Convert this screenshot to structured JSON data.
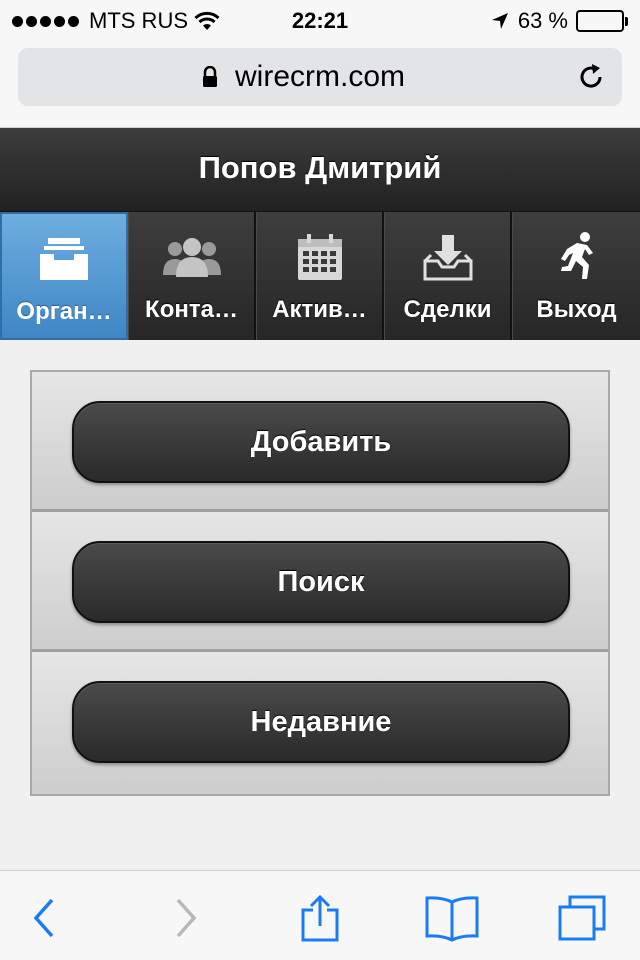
{
  "status_bar": {
    "carrier": "MTS RUS",
    "time": "22:21",
    "battery_percent": "63 %",
    "battery_level": 0.63,
    "icons": [
      "signal-dots-icon",
      "wifi-icon",
      "location-arrow-icon",
      "battery-icon"
    ]
  },
  "browser": {
    "url": "wirecrm.com",
    "icons": [
      "lock-icon",
      "reload-icon"
    ]
  },
  "header": {
    "title": "Попов Дмитрий"
  },
  "nav": {
    "items": [
      {
        "label": "Организации",
        "display": "Орган…",
        "icon": "inbox-tray-icon",
        "active": true
      },
      {
        "label": "Контакты",
        "display": "Конта…",
        "icon": "contacts-people-icon",
        "active": false
      },
      {
        "label": "Активности",
        "display": "Актив…",
        "icon": "calendar-icon",
        "active": false
      },
      {
        "label": "Сделки",
        "display": "Сделки",
        "icon": "download-tray-icon",
        "active": false
      },
      {
        "label": "Выход",
        "display": "Выход",
        "icon": "running-man-icon",
        "active": false
      }
    ],
    "active_color": "#4a90cc"
  },
  "actions": {
    "add_label": "Добавить",
    "search_label": "Поиск",
    "recent_label": "Недавние"
  },
  "toolbar": {
    "icons": [
      "back-icon",
      "forward-icon",
      "share-icon",
      "bookmarks-icon",
      "tabs-icon"
    ],
    "accent": "#1a7cf5"
  }
}
